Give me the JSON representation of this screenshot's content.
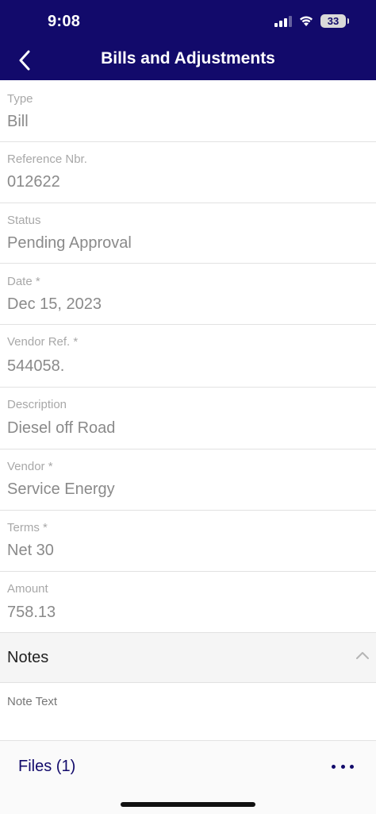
{
  "status_bar": {
    "time": "9:08",
    "battery": "33"
  },
  "header": {
    "title": "Bills and Adjustments"
  },
  "fields": [
    {
      "label": "Type",
      "value": "Bill"
    },
    {
      "label": "Reference Nbr.",
      "value": "012622"
    },
    {
      "label": "Status",
      "value": "Pending Approval"
    },
    {
      "label": "Date *",
      "value": "Dec 15, 2023"
    },
    {
      "label": "Vendor Ref. *",
      "value": "544058."
    },
    {
      "label": "Description",
      "value": "Diesel off Road"
    },
    {
      "label": "Vendor *",
      "value": "Service Energy"
    },
    {
      "label": "Terms *",
      "value": "Net 30"
    },
    {
      "label": "Amount",
      "value": "758.13"
    }
  ],
  "notes": {
    "title": "Notes",
    "note_text_label": "Note Text"
  },
  "files": {
    "label": "Files (1)"
  },
  "icons": {
    "back": "chevron-left-icon",
    "collapse": "chevron-up-icon",
    "more": "more-horizontal-icon"
  },
  "colors": {
    "header_bg": "#120a6b",
    "accent": "#120a6b"
  }
}
